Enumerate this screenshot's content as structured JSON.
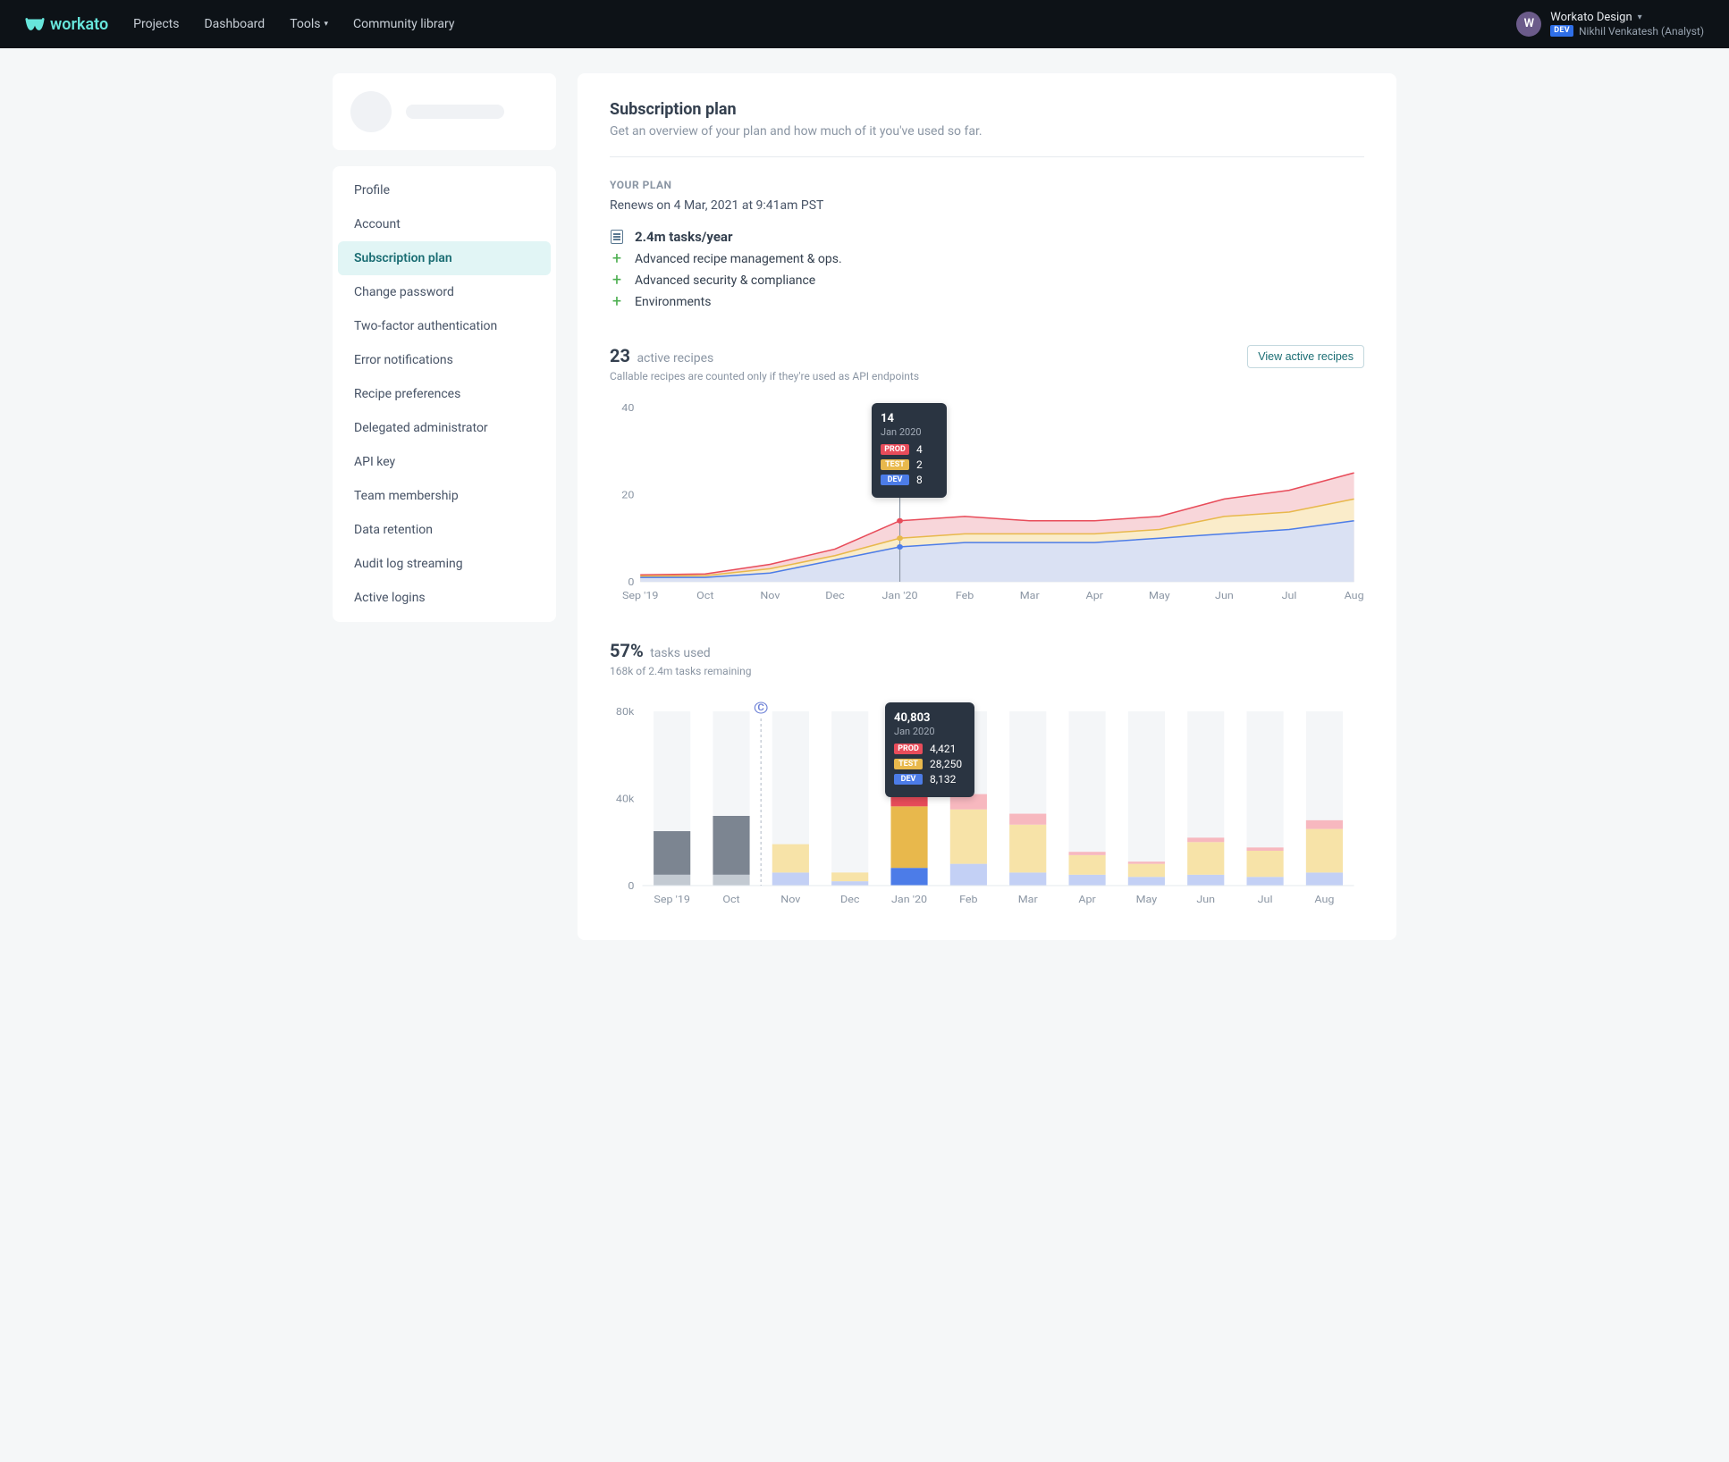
{
  "nav": {
    "brand": "workato",
    "links": [
      "Projects",
      "Dashboard",
      "Tools",
      "Community library"
    ],
    "user": {
      "avatar_letter": "W",
      "workspace": "Workato Design",
      "env_badge": "DEV",
      "name_role": "Nikhil Venkatesh (Analyst)"
    }
  },
  "sidebar": {
    "items": [
      "Profile",
      "Account",
      "Subscription plan",
      "Change password",
      "Two-factor authentication",
      "Error notifications",
      "Recipe preferences",
      "Delegated administrator",
      "API key",
      "Team membership",
      "Data retention",
      "Audit log streaming",
      "Active logins"
    ],
    "active_index": 2
  },
  "header": {
    "title": "Subscription plan",
    "subtitle": "Get an overview of your plan and how much of it you've used so far."
  },
  "plan": {
    "label": "YOUR PLAN",
    "renews": "Renews on 4 Mar, 2021 at 9:41am PST",
    "tasks_summary": "2.4m tasks/year",
    "features": [
      "Advanced recipe management & ops.",
      "Advanced security & compliance",
      "Environments"
    ]
  },
  "recipes_chart": {
    "count": "23",
    "count_label": "active recipes",
    "hint": "Callable recipes are counted only if they're used as API endpoints",
    "button": "View active recipes",
    "tooltip": {
      "total": "14",
      "period": "Jan 2020",
      "rows": [
        {
          "badge": "PROD",
          "cls": "b-prod",
          "val": "4"
        },
        {
          "badge": "TEST",
          "cls": "b-test",
          "val": "2"
        },
        {
          "badge": "DEV",
          "cls": "b-dev",
          "val": "8"
        }
      ]
    }
  },
  "tasks_chart": {
    "percent": "57%",
    "percent_label": "tasks used",
    "hint": "168k of 2.4m tasks remaining",
    "tooltip": {
      "total": "40,803",
      "period": "Jan 2020",
      "rows": [
        {
          "badge": "PROD",
          "cls": "b-prod",
          "val": "4,421"
        },
        {
          "badge": "TEST",
          "cls": "b-test",
          "val": "28,250"
        },
        {
          "badge": "DEV",
          "cls": "b-dev",
          "val": "8,132"
        }
      ]
    }
  },
  "chart_data": [
    {
      "type": "area",
      "title": "Active recipes",
      "ylim": [
        0,
        40
      ],
      "yticks": [
        0,
        20,
        40
      ],
      "categories": [
        "Sep '19",
        "Oct",
        "Nov",
        "Dec",
        "Jan '20",
        "Feb",
        "Mar",
        "Apr",
        "May",
        "Jun",
        "Jul",
        "Aug"
      ],
      "series": [
        {
          "name": "PROD",
          "color": "#e84c5a",
          "values": [
            0.3,
            0.4,
            1,
            1.5,
            4,
            4,
            3,
            3,
            3,
            4,
            5,
            6
          ]
        },
        {
          "name": "TEST",
          "color": "#e8b84c",
          "values": [
            0.3,
            0.4,
            1,
            1,
            2,
            2,
            2,
            2,
            2,
            4,
            4,
            5
          ]
        },
        {
          "name": "DEV",
          "color": "#4c7ce8",
          "values": [
            1,
            1,
            2,
            5,
            8,
            9,
            9,
            9,
            10,
            11,
            12,
            14
          ]
        }
      ],
      "highlight_index": 4
    },
    {
      "type": "bar",
      "title": "Tasks used",
      "ylim": [
        0,
        80000
      ],
      "yticks": [
        0,
        40000,
        80000
      ],
      "ytick_labels": [
        "0",
        "40k",
        "80k"
      ],
      "categories": [
        "Sep '19",
        "Oct",
        "Nov",
        "Dec",
        "Jan '20",
        "Feb",
        "Mar",
        "Apr",
        "May",
        "Jun",
        "Jul",
        "Aug"
      ],
      "series": [
        {
          "name": "PROD",
          "color": "#e84c5a",
          "values": [
            0,
            0,
            0,
            0,
            4421,
            7000,
            5000,
            1500,
            1000,
            2000,
            1500,
            4000
          ]
        },
        {
          "name": "TEST",
          "color": "#e8b84c",
          "values": [
            0,
            0,
            13000,
            4000,
            28250,
            25000,
            22000,
            9000,
            6000,
            15000,
            12000,
            20000
          ]
        },
        {
          "name": "DEV",
          "color": "#4c7ce8",
          "values": [
            0,
            0,
            6000,
            2000,
            8132,
            10000,
            6000,
            5000,
            4000,
            5000,
            4000,
            6000
          ]
        }
      ],
      "gray_series": {
        "name": "previous",
        "color_dark": "#7c8591",
        "color_light": "#c3cad2",
        "values_dark": [
          20000,
          27000,
          0,
          0,
          0,
          0,
          0,
          0,
          0,
          0,
          0,
          0
        ],
        "values_light": [
          5000,
          5000,
          0,
          0,
          0,
          0,
          0,
          0,
          0,
          0,
          0,
          0
        ]
      },
      "highlight_index": 4,
      "cycle_marker_index": 2
    }
  ]
}
